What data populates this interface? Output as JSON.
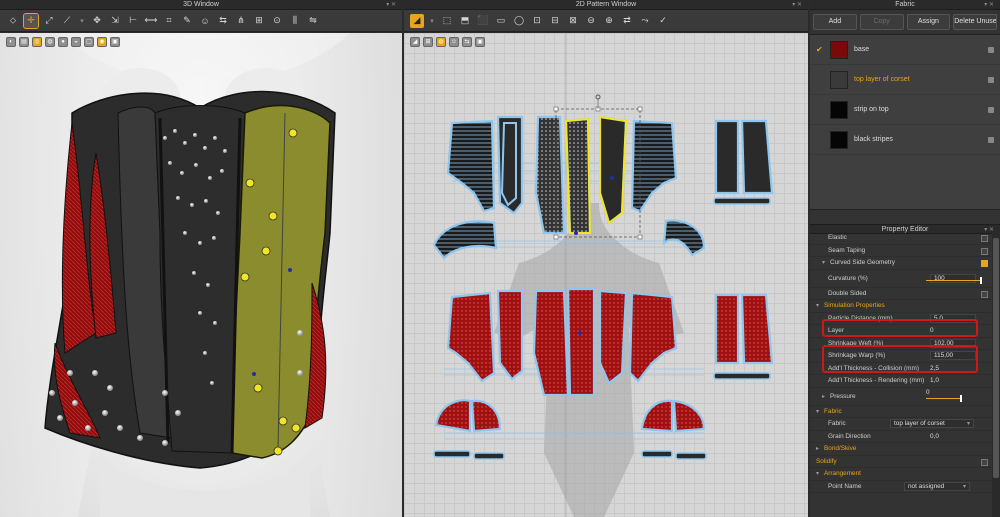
{
  "windows": {
    "left_title": "3D Window",
    "center_title": "2D Pattern Window",
    "right_title": "Fabric"
  },
  "fabric_panel": {
    "buttons": [
      "Add",
      "Copy",
      "Assign",
      "Delete Unused"
    ],
    "items": [
      {
        "name": "base",
        "color": "#7a0a0a",
        "checked": true
      },
      {
        "name": "top layer of corset",
        "color": "#3a3a3a",
        "selected": true
      },
      {
        "name": "strip on top",
        "color": "#050505"
      },
      {
        "name": "black stripes",
        "color": "#050505"
      }
    ]
  },
  "property_editor": {
    "title": "Property Editor",
    "rows": {
      "elastic": "Elastic",
      "seam_taping": "Seam Taping",
      "curved_side_geometry": "Curved Side Geometry",
      "curvature_label": "Curvature (%)",
      "curvature_value": "100",
      "double_sided": "Double Sided",
      "simulation_properties": "Simulation Properties",
      "particle_distance_label": "Particle Distance (mm)",
      "particle_distance_value": "5,0",
      "layer_label": "Layer",
      "layer_value": "0",
      "shrinkage_weft_label": "Shrinkage Weft (%)",
      "shrinkage_weft_value": "102,00",
      "shrinkage_warp_label": "Shrinkage Warp (%)",
      "shrinkage_warp_value": "115,00",
      "collision_label": "Add'l Thickness - Collision (mm)",
      "collision_value": "2,5",
      "rendering_label": "Add'l Thickness - Rendering (mm)",
      "rendering_value": "1,0",
      "pressure_label": "Pressure",
      "pressure_value": "0",
      "fabric_section": "Fabric",
      "fabric_label": "Fabric",
      "fabric_value": "top layer of corset",
      "grain_label": "Grain Direction",
      "grain_value": "0,0",
      "bond_section": "Bond/Skive",
      "solidify_section": "Solidify",
      "arrangement_section": "Arrangement",
      "point_name_label": "Point Name",
      "point_name_value": "not assigned"
    }
  },
  "colors": {
    "accent": "#e7a51b",
    "highlight_red": "#d01818",
    "corset_black": "#2f2f2f",
    "corset_olive": "#8a8c2e",
    "corset_red": "#a01010",
    "pattern_outline": "#8ec6ee",
    "selection_yellow": "#f2e624"
  }
}
